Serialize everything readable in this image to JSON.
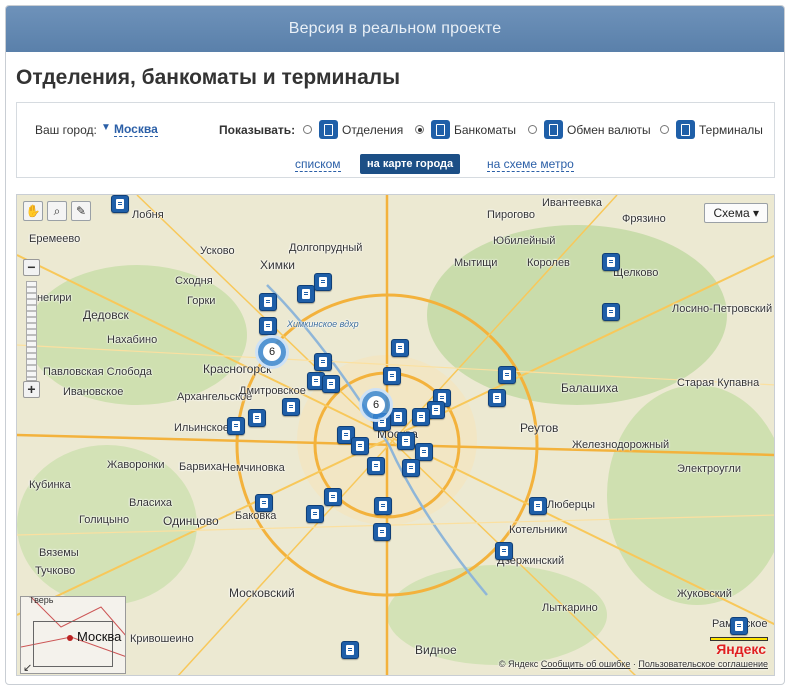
{
  "banner": {
    "text": "Версия в реальном проекте"
  },
  "page_title": "Отделения, банкоматы и терминалы",
  "filter": {
    "city_label": "Ваш город:",
    "city_value": "Москва",
    "show_label": "Показывать:",
    "options": [
      {
        "label": "Отделения",
        "icon": "branch-icon",
        "checked": false
      },
      {
        "label": "Банкоматы",
        "icon": "atm-icon",
        "checked": true
      },
      {
        "label": "Обмен валюты",
        "icon": "currency-exchange-icon",
        "checked": false
      },
      {
        "label": "Терминалы",
        "icon": "terminal-icon",
        "checked": false
      }
    ],
    "views": {
      "list": "списком",
      "city_map": "на карте города",
      "metro": "на схеме метро"
    }
  },
  "map": {
    "scheme_button": "Схема",
    "minimap_label": "Москва",
    "minimap_label2": "Тверь",
    "clusters": [
      "6",
      "6"
    ],
    "labels": [
      "Лобня",
      "Пирогово",
      "Ивантеевка",
      "Еремеево",
      "Долгопрудный",
      "Фрязино",
      "Юбилейный",
      "Усково",
      "Мытищи",
      "Королев",
      "Щелково",
      "Химки",
      "Сходня",
      "Горки",
      "Лосино-Петровский",
      "Дедовск",
      "Нахабино",
      "Снегири",
      "Красногорск",
      "Балашиха",
      "Старая Купавна",
      "Реутов",
      "Железнодорожный",
      "Москва",
      "Электроугли",
      "Одинцово",
      "Котельники",
      "Люберцы",
      "Дзержинский",
      "Московский",
      "Видное",
      "Лыткарино",
      "Жуковский",
      "Раменское",
      "Павловская Слобода",
      "Ивановское",
      "Архангельское",
      "Ильинское",
      "Немчиновка",
      "Баковка",
      "Власиха",
      "Барвиха",
      "Голицыно",
      "Кубинка",
      "Дмитровское",
      "Химкинское вдхр",
      "Кривошеино",
      "Жаворонки",
      "Вяземы",
      "Тучково"
    ],
    "copyright": "© Яндекс",
    "report_error": "Сообщить об ошибке",
    "user_agreement": "Пользовательское соглашение",
    "logo": "Яндекс"
  },
  "colors": {
    "banner": "#5f86b0",
    "accent_blue": "#1f5fa8",
    "link_blue": "#2b5fa7",
    "active_view_bg": "#1c4f86"
  }
}
